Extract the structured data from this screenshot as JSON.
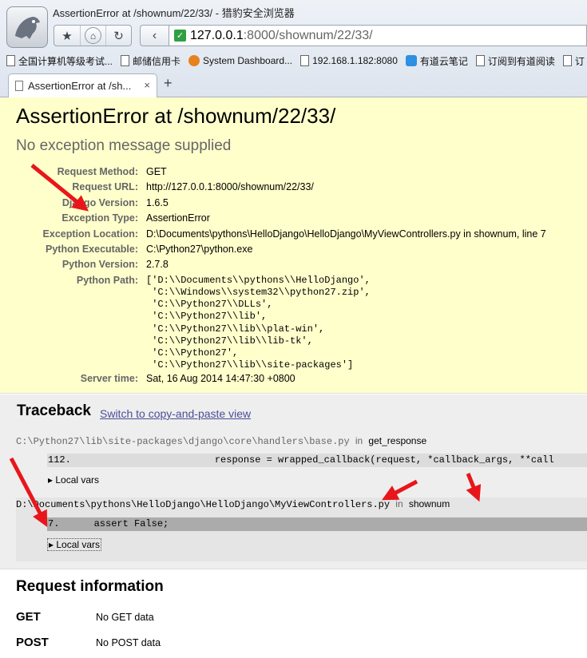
{
  "browser": {
    "window_title": "AssertionError at /shownum/22/33/ - 猎豹安全浏览器",
    "url_host": "127.0.0.1",
    "url_rest": ":8000/shownum/22/33/",
    "nav": {
      "favorite": "★",
      "home": "⌂",
      "refresh": "↻",
      "back": "‹"
    },
    "bookmarks": [
      {
        "label": "全国计算机等级考试...",
        "icon": "page-icon"
      },
      {
        "label": "邮储信用卡",
        "icon": "page-icon"
      },
      {
        "label": "System Dashboard...",
        "icon": "orange-logo-icon"
      },
      {
        "label": "192.168.1.182:8080",
        "icon": "page-icon"
      },
      {
        "label": "有道云笔记",
        "icon": "note-icon"
      },
      {
        "label": "订阅到有道阅读",
        "icon": "page-icon"
      },
      {
        "label": "订",
        "icon": "page-icon"
      }
    ],
    "tab": {
      "label": "AssertionError at /sh...",
      "close": "×"
    },
    "new_tab": "+"
  },
  "summary": {
    "title": "AssertionError at /shownum/22/33/",
    "subtitle": "No exception message supplied",
    "rows": [
      {
        "key": "Request Method:",
        "value": "GET"
      },
      {
        "key": "Request URL:",
        "value": "http://127.0.0.1:8000/shownum/22/33/"
      },
      {
        "key": "Django Version:",
        "value": "1.6.5"
      },
      {
        "key": "Exception Type:",
        "value": "AssertionError"
      },
      {
        "key": "Exception Location:",
        "value": "D:\\Documents\\pythons\\HelloDjango\\HelloDjango\\MyViewControllers.py in shownum, line 7"
      },
      {
        "key": "Python Executable:",
        "value": "C:\\Python27\\python.exe"
      },
      {
        "key": "Python Version:",
        "value": "2.7.8"
      }
    ],
    "python_path_key": "Python Path:",
    "python_path_value": "['D:\\\\Documents\\\\pythons\\\\HelloDjango',\n 'C:\\\\Windows\\\\system32\\\\python27.zip',\n 'C:\\\\Python27\\\\DLLs',\n 'C:\\\\Python27\\\\lib',\n 'C:\\\\Python27\\\\lib\\\\plat-win',\n 'C:\\\\Python27\\\\lib\\\\lib-tk',\n 'C:\\\\Python27',\n 'C:\\\\Python27\\\\lib\\\\site-packages']",
    "server_time_key": "Server time:",
    "server_time_value": "Sat, 16 Aug 2014 14:47:30 +0800"
  },
  "traceback": {
    "heading": "Traceback",
    "switch_link": "Switch to copy-and-paste view",
    "frames": [
      {
        "path": "C:\\Python27\\lib\\site-packages\\django\\core\\handlers\\base.py",
        "in": "in",
        "function": "get_response",
        "context_line": "112.                         response = wrapped_callback(request, *callback_args, **call",
        "local_vars": "▸ Local vars"
      },
      {
        "path": "D:\\Documents\\pythons\\HelloDjango\\HelloDjango\\MyViewControllers.py",
        "in": "in",
        "function": "shownum",
        "context_line": "7.      assert False;",
        "local_vars": "▸ Local vars"
      }
    ]
  },
  "request_info": {
    "heading": "Request information",
    "get_key": "GET",
    "get_value": "No GET data",
    "post_key": "POST",
    "post_value": "No POST data"
  },
  "colors": {
    "summary_bg": "#ffffcc",
    "traceback_bg": "#eeeeee",
    "annotation_arrow": "#e8161b"
  }
}
